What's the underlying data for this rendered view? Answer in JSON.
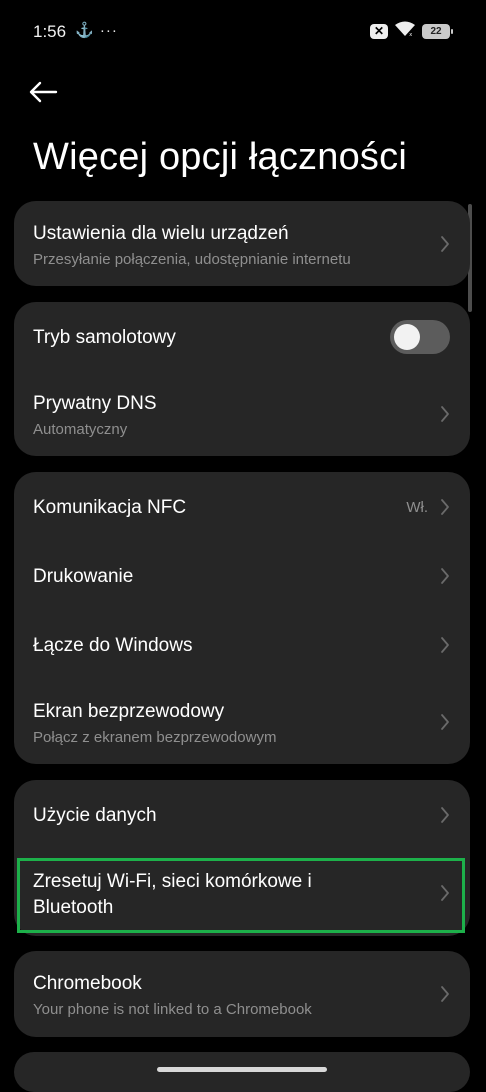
{
  "status_bar": {
    "time": "1:56",
    "left_icons": "⚓ ···",
    "battery": "22"
  },
  "header": {
    "title": "Więcej opcji łączności"
  },
  "sections": {
    "multi_device": {
      "title": "Ustawienia dla wielu urządzeń",
      "subtitle": "Przesyłanie połączenia, udostępnianie internetu"
    },
    "airplane": {
      "title": "Tryb samolotowy",
      "enabled": false
    },
    "private_dns": {
      "title": "Prywatny DNS",
      "subtitle": "Automatyczny"
    },
    "nfc": {
      "title": "Komunikacja NFC",
      "value": "Wł."
    },
    "printing": {
      "title": "Drukowanie"
    },
    "link_windows": {
      "title": "Łącze do Windows"
    },
    "wireless_display": {
      "title": "Ekran bezprzewodowy",
      "subtitle": "Połącz z ekranem bezprzewodowym"
    },
    "data_usage": {
      "title": "Użycie danych"
    },
    "reset_network": {
      "title_line1": "Zresetuj Wi-Fi, sieci komórkowe i",
      "title_line2": "Bluetooth"
    },
    "chromebook": {
      "title": "Chromebook",
      "subtitle": "Your phone is not linked to a Chromebook"
    }
  },
  "colors": {
    "background": "#000000",
    "card": "#262626",
    "secondary_text": "#8f8f8f",
    "highlight": "#1db04a"
  }
}
